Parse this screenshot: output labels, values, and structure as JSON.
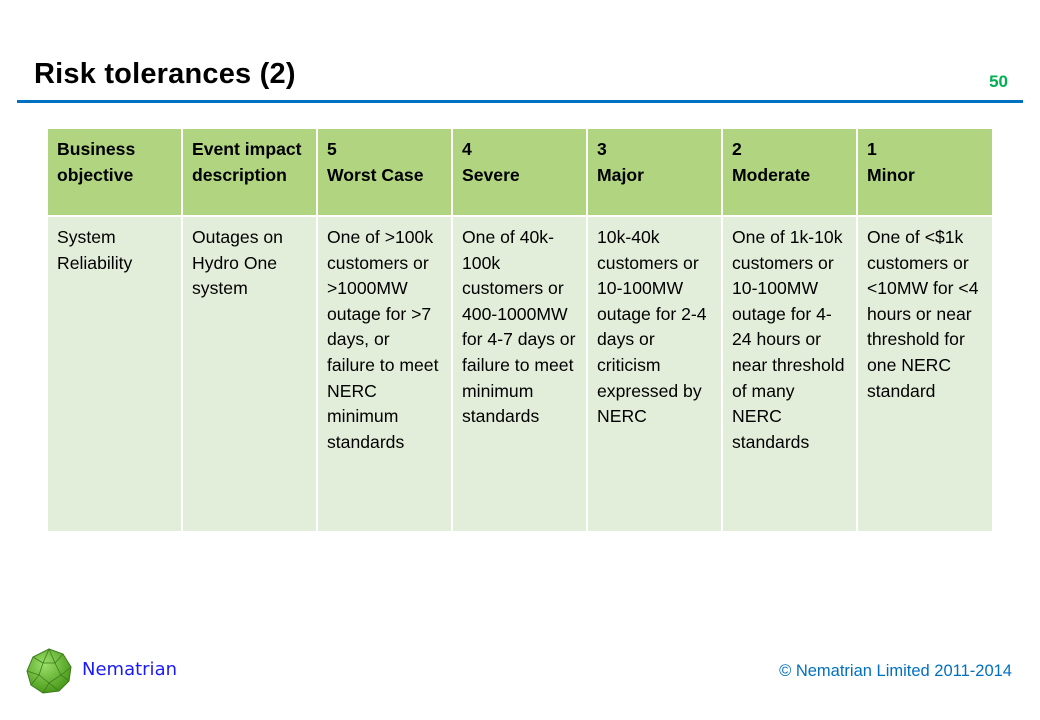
{
  "slide": {
    "title": "Risk tolerances (2)",
    "page_number": "50"
  },
  "table": {
    "headers": [
      "Business objective",
      "Event impact description",
      "5\nWorst Case",
      "4\nSevere",
      "3\nMajor",
      "2\nModerate",
      "1\nMinor"
    ],
    "rows": [
      [
        "System Reliability",
        "Outages on Hydro One system",
        "One of >100k customers or >1000MW outage for >7 days, or failure to meet NERC minimum standards",
        "One of 40k-100k customers or 400-1000MW for 4-7 days or failure to meet minimum standards",
        "10k-40k customers or 10-100MW outage for 2-4 days or criticism expressed by NERC",
        "One of 1k-10k customers or 10-100MW outage for 4-24 hours or near threshold of many NERC standards",
        "One of <$1k customers or <10MW for <4 hours or near threshold for one NERC standard"
      ]
    ]
  },
  "footer": {
    "brand": "Nematrian",
    "copyright": "© Nematrian Limited 2011-2014",
    "logo_icon": "green-polyhedron-icon"
  },
  "colors": {
    "header_fill": "#b0d480",
    "body_fill": "#e3eeda",
    "rule": "#0070c0",
    "page_number": "#00b050"
  }
}
